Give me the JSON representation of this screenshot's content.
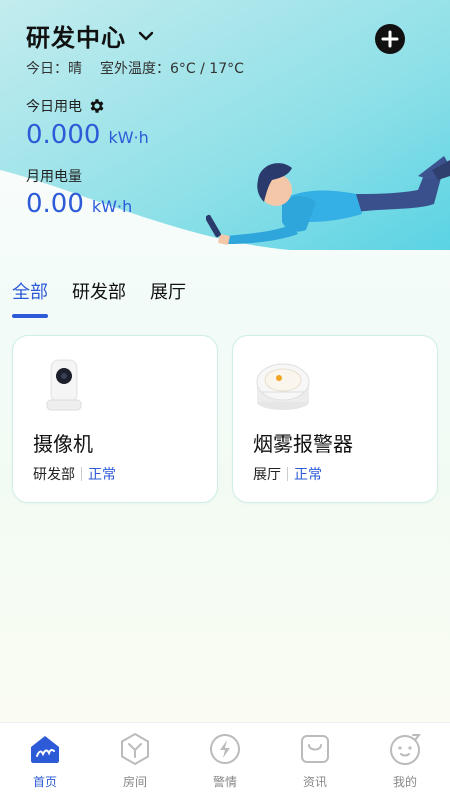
{
  "header": {
    "title": "研发中心",
    "weather_today": "今日：晴",
    "weather_outdoor": "室外温度：6°C / 17°C",
    "today_power_label": "今日用电",
    "today_power_value": "0.000",
    "today_power_unit": "kW·h",
    "month_power_label": "月用电量",
    "month_power_value": "0.00",
    "month_power_unit": "kW·h"
  },
  "tabs": [
    {
      "label": "全部",
      "active": true
    },
    {
      "label": "研发部",
      "active": false
    },
    {
      "label": "展厅",
      "active": false
    }
  ],
  "devices": [
    {
      "name": "摄像机",
      "room": "研发部",
      "status": "正常",
      "icon": "camera-icon"
    },
    {
      "name": "烟雾报警器",
      "room": "展厅",
      "status": "正常",
      "icon": "smoke-detector-icon"
    }
  ],
  "tabbar": [
    {
      "label": "首页",
      "icon": "home-icon",
      "active": true
    },
    {
      "label": "房间",
      "icon": "room-icon",
      "active": false
    },
    {
      "label": "警情",
      "icon": "alert-icon",
      "active": false
    },
    {
      "label": "资讯",
      "icon": "news-icon",
      "active": false
    },
    {
      "label": "我的",
      "icon": "profile-icon",
      "active": false
    }
  ],
  "colors": {
    "accent": "#2d5bd8",
    "hero_cyan": "#5ad3e3",
    "card_border": "#cfeee8"
  }
}
